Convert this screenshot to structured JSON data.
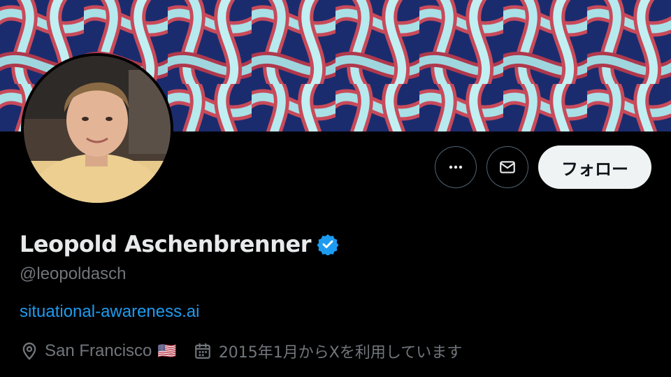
{
  "profile": {
    "name": "Leopold Aschenbrenner",
    "handle": "@leopoldasch",
    "website": "situational-awareness.ai",
    "location": "San Francisco",
    "location_flag": "🇺🇸",
    "joined": "2015年1月からXを利用しています",
    "verified": true
  },
  "actions": {
    "more_icon": "more-horizontal-icon",
    "message_icon": "envelope-icon",
    "follow_label": "フォロー"
  },
  "colors": {
    "background": "#000000",
    "accent": "#1d9bf0",
    "secondary_text": "#71767b",
    "follow_button_bg": "#eff3f4"
  }
}
